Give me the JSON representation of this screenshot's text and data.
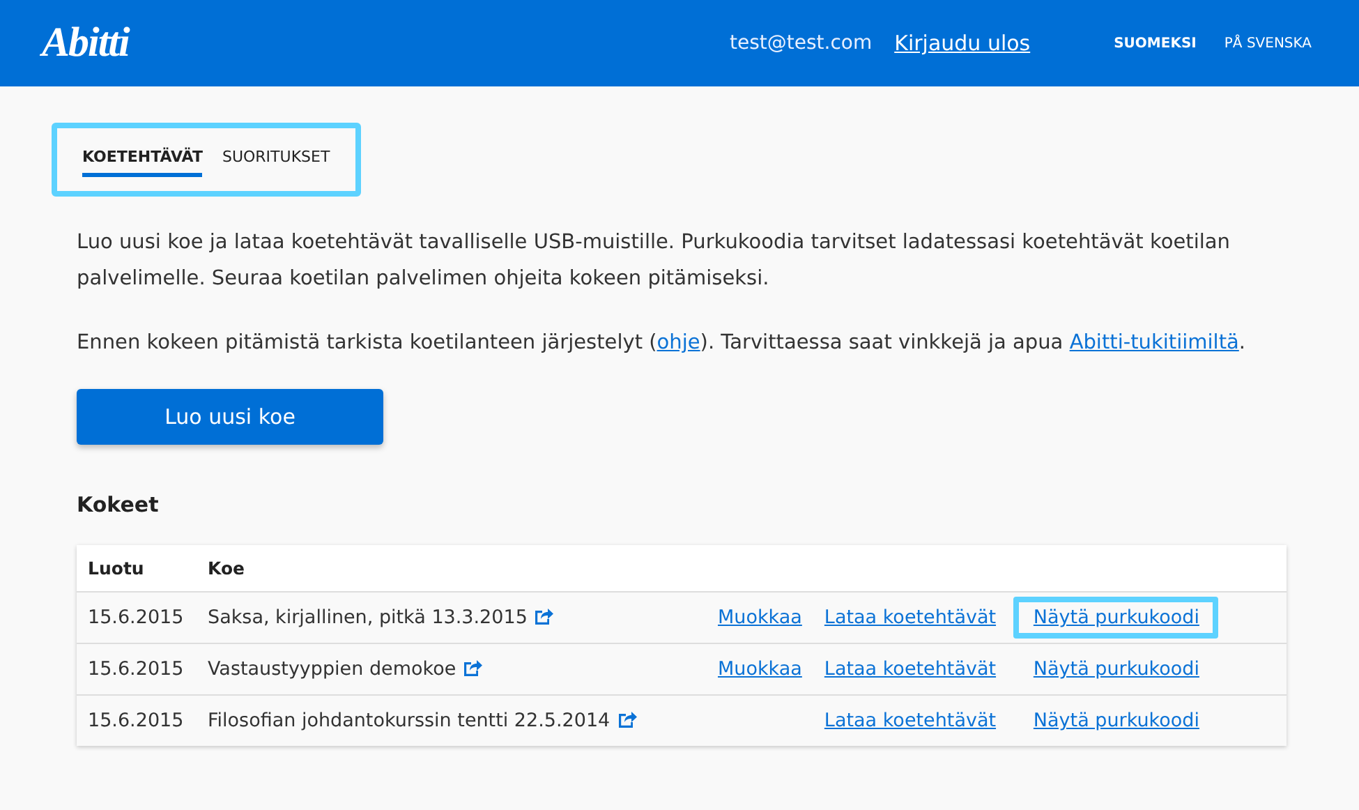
{
  "header": {
    "logo": "Abitti",
    "user": "test@test.com",
    "logout": "Kirjaudu ulos",
    "languages": [
      {
        "label": "SUOMEKSI",
        "selected": true
      },
      {
        "label": "PÅ SVENSKA",
        "selected": false
      }
    ]
  },
  "tabs_highlighted": true,
  "tabs": [
    {
      "label": "KOETEHTÄVÄT",
      "selected": true
    },
    {
      "label": "SUORITUKSET",
      "selected": false
    }
  ],
  "intro": "Luo uusi koe ja lataa koetehtävät tavalliselle USB-muistille. Purkukoodia tarvitset ladatessasi koetehtävät koetilan palvelimelle. Seuraa koetilan palvelimen ohjeita kokeen pitämiseksi.",
  "notice": [
    {
      "kind": "text",
      "text": "Ennen kokeen pitämistä tarkista koetilanteen järjestelyt ("
    },
    {
      "kind": "link",
      "text": "ohje"
    },
    {
      "kind": "text",
      "text": "). Tarvittaessa saat vinkkejä ja apua "
    },
    {
      "kind": "link",
      "text": "Abitti-tukitiimiltä"
    },
    {
      "kind": "text",
      "text": "."
    }
  ],
  "create_button": "Luo uusi koe",
  "exams_heading": "Kokeet",
  "table": {
    "columns": [
      "Luotu",
      "Koe"
    ],
    "rows": [
      {
        "created": "15.6.2015",
        "name": "Saksa, kirjallinen, pitkä 13.3.2015",
        "edit": "Muokkaa",
        "download": "Lataa koetehtävät",
        "code": "Näytä purkukoodi",
        "highlighted": true
      },
      {
        "created": "15.6.2015",
        "name": "Vastaustyyppien demokoe",
        "edit": "Muokkaa",
        "download": "Lataa koetehtävät",
        "code": "Näytä purkukoodi",
        "highlighted": false
      },
      {
        "created": "15.6.2015",
        "name": "Filosofian johdantokurssin tentti 22.5.2014",
        "download": "Lataa koetehtävät",
        "code": "Näytä purkukoodi",
        "highlighted": false
      }
    ]
  }
}
